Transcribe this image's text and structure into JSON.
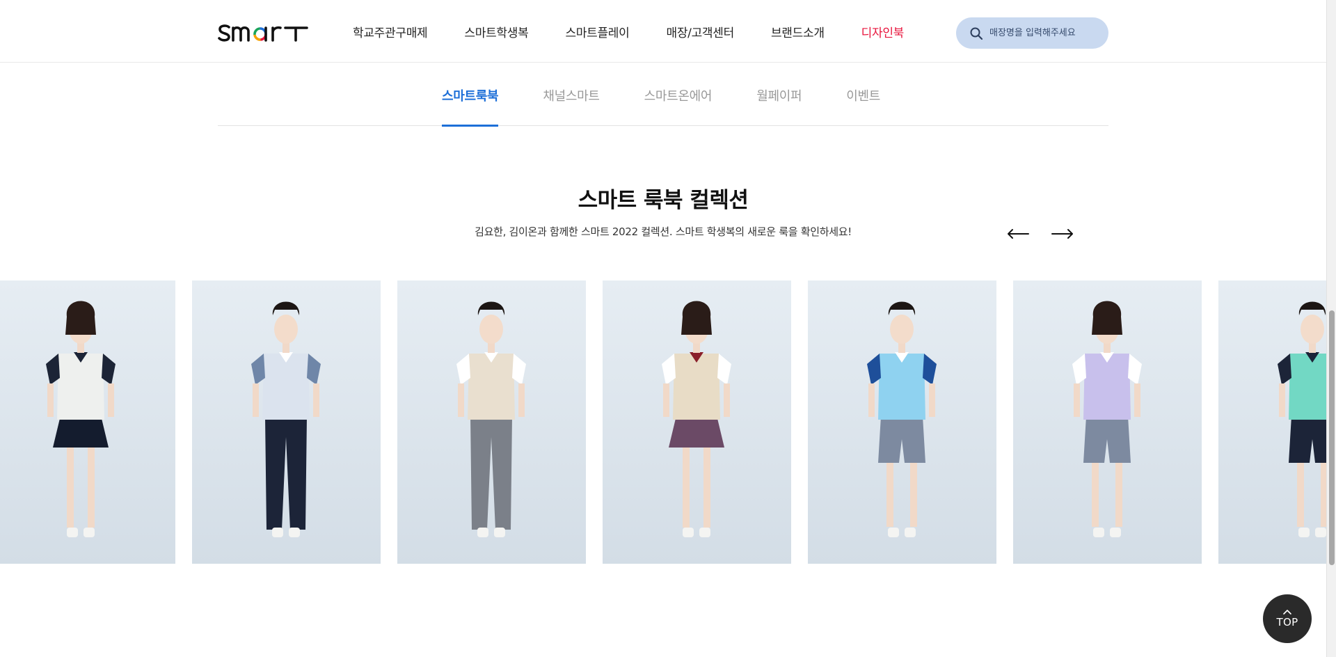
{
  "header": {
    "logo_text": "smart",
    "nav": [
      {
        "label": "학교주관구매제"
      },
      {
        "label": "스마트학생복"
      },
      {
        "label": "스마트플레이"
      },
      {
        "label": "매장/고객센터"
      },
      {
        "label": "브랜드소개"
      },
      {
        "label": "디자인북"
      }
    ],
    "search": {
      "placeholder": "매장명을 입력해주세요",
      "value": "",
      "icon": "search-icon"
    },
    "colors": {
      "accent_nav": "#e8143c",
      "search_bg": "#c9d9f0"
    }
  },
  "subtabs": {
    "items": [
      {
        "label": "스마트룩북",
        "active": true
      },
      {
        "label": "채널스마트",
        "active": false
      },
      {
        "label": "스마트온에어",
        "active": false
      },
      {
        "label": "월페이퍼",
        "active": false
      },
      {
        "label": "이벤트",
        "active": false
      }
    ],
    "active_color": "#1d6fd8"
  },
  "collection": {
    "title": "스마트 룩북 컬렉션",
    "description": "김요한, 김이온과 함께한 스마트 2022 컬렉션. 스마트 학생복의 새로운 룩을 확인하세요!",
    "prev_icon": "arrow-left-icon",
    "next_icon": "arrow-right-icon"
  },
  "lookbook": [
    {
      "model": "female",
      "top": "#eef0ee",
      "top_accent": "#1c2436",
      "bottom": "#141c2e",
      "bottom_type": "skirt",
      "collar": "#1c2436"
    },
    {
      "model": "male",
      "top": "#dbe3ee",
      "top_accent": "#6f86a8",
      "bottom": "#1c2438",
      "bottom_type": "pants",
      "collar": "#ffffff"
    },
    {
      "model": "male",
      "top": "#e9dfcf",
      "top_accent": "#ffffff",
      "bottom": "#7b8089",
      "bottom_type": "pants",
      "collar": "#ffffff"
    },
    {
      "model": "female",
      "top": "#e8dcc6",
      "top_accent": "#ffffff",
      "bottom": "#6b4a66",
      "bottom_type": "skirt",
      "collar": "#8a1f2a"
    },
    {
      "model": "male",
      "top": "#8fd2f0",
      "top_accent": "#1e4f9a",
      "bottom": "#7d8aa0",
      "bottom_type": "shorts",
      "collar": "#ffffff"
    },
    {
      "model": "female",
      "top": "#c8c0ec",
      "top_accent": "#ffffff",
      "bottom": "#7d8aa0",
      "bottom_type": "shorts",
      "collar": "#ffffff"
    },
    {
      "model": "male",
      "top": "#72d8c4",
      "top_accent": "#1c2438",
      "bottom": "#1c2438",
      "bottom_type": "shorts",
      "collar": "#1c2438"
    }
  ],
  "top_button": {
    "label": "TOP",
    "icon": "chevron-up-icon"
  }
}
